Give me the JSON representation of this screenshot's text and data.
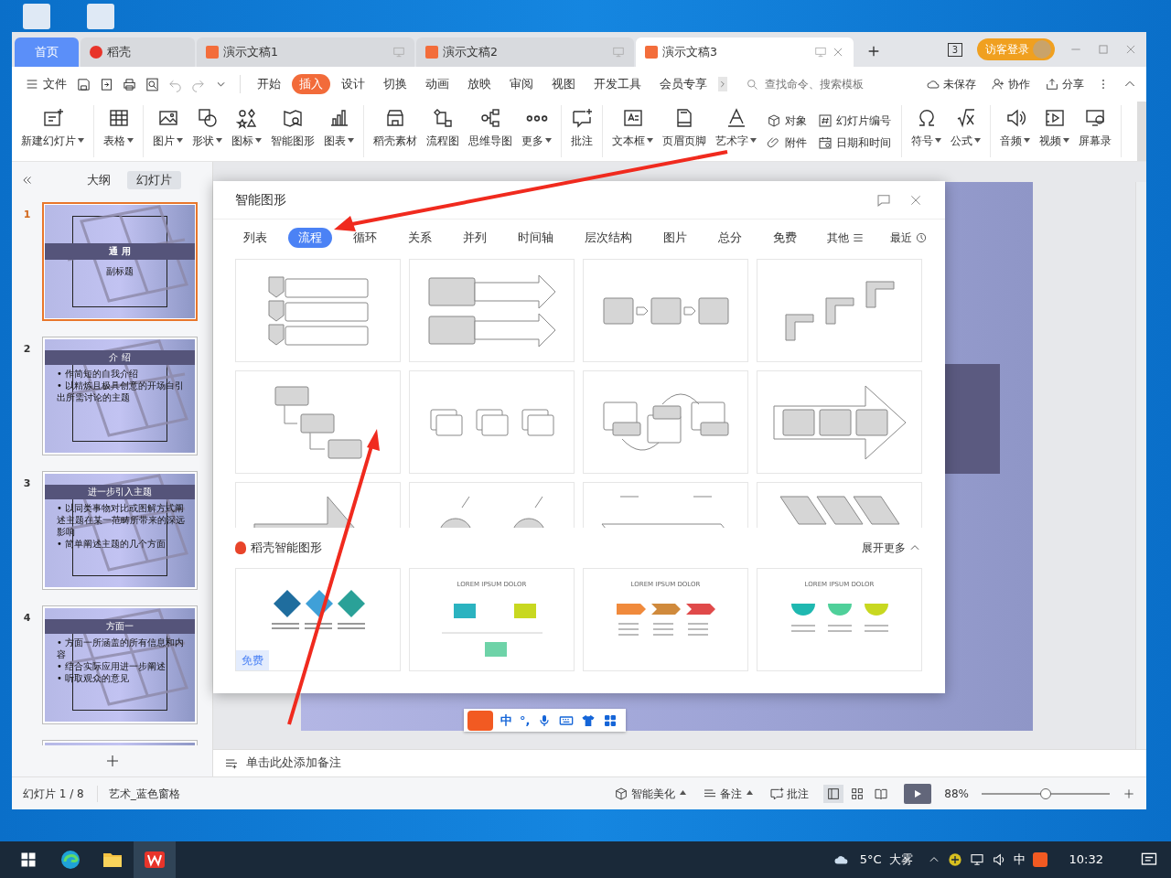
{
  "window_tabs": [
    {
      "label": "首页",
      "kind": "home",
      "selected": false
    },
    {
      "label": "稻壳",
      "kind": "daoke",
      "selected": false
    },
    {
      "label": "演示文稿1",
      "kind": "doc",
      "selected": false
    },
    {
      "label": "演示文稿2",
      "kind": "doc",
      "selected": false
    },
    {
      "label": "演示文稿3",
      "kind": "doc",
      "selected": true
    }
  ],
  "window_count": "3",
  "login_button": "访客登录",
  "file_menu": "文件",
  "menu_tabs": [
    {
      "label": "开始",
      "selected": false
    },
    {
      "label": "插入",
      "selected": true
    },
    {
      "label": "设计",
      "selected": false
    },
    {
      "label": "切换",
      "selected": false
    },
    {
      "label": "动画",
      "selected": false
    },
    {
      "label": "放映",
      "selected": false
    },
    {
      "label": "审阅",
      "selected": false
    },
    {
      "label": "视图",
      "selected": false
    },
    {
      "label": "开发工具",
      "selected": false
    },
    {
      "label": "会员专享",
      "selected": false
    }
  ],
  "search": {
    "placeholder": "查找命令、搜索模板"
  },
  "right_actions": [
    "未保存",
    "协作",
    "分享"
  ],
  "ribbon_groups": [
    [
      {
        "kind": "large",
        "label": "新建幻灯片",
        "dropdown": true
      }
    ],
    [
      {
        "kind": "large",
        "label": "表格",
        "dropdown": true
      }
    ],
    [
      {
        "kind": "large",
        "label": "图片",
        "dropdown": true
      },
      {
        "kind": "large",
        "label": "形状",
        "dropdown": true
      },
      {
        "kind": "large",
        "label": "图标",
        "dropdown": true
      },
      {
        "kind": "large",
        "label": "智能图形",
        "dropdown": false
      },
      {
        "kind": "large",
        "label": "图表",
        "dropdown": true
      }
    ],
    [
      {
        "kind": "large",
        "label": "稻壳素材",
        "dropdown": false
      },
      {
        "kind": "large",
        "label": "流程图",
        "dropdown": false
      },
      {
        "kind": "large",
        "label": "思维导图",
        "dropdown": false
      },
      {
        "kind": "large",
        "label": "更多",
        "dropdown": true
      }
    ],
    [
      {
        "kind": "large",
        "label": "批注",
        "dropdown": false
      }
    ],
    [
      {
        "kind": "large",
        "label": "文本框",
        "dropdown": true
      },
      {
        "kind": "large",
        "label": "页眉页脚",
        "dropdown": false
      },
      {
        "kind": "large",
        "label": "艺术字",
        "dropdown": true
      },
      {
        "kind": "stack",
        "items": [
          "对象",
          "附件"
        ]
      },
      {
        "kind": "stack",
        "items": [
          "幻灯片编号",
          "日期和时间"
        ]
      }
    ],
    [
      {
        "kind": "large",
        "label": "符号",
        "dropdown": true
      },
      {
        "kind": "large",
        "label": "公式",
        "dropdown": true
      }
    ],
    [
      {
        "kind": "large",
        "label": "音频",
        "dropdown": true
      },
      {
        "kind": "large",
        "label": "视频",
        "dropdown": true
      },
      {
        "kind": "large",
        "label": "屏幕录",
        "dropdown": false
      }
    ]
  ],
  "panel_tabs": [
    {
      "label": "大纲",
      "selected": false
    },
    {
      "label": "幻灯片",
      "selected": true
    }
  ],
  "slides": [
    {
      "number": "1",
      "selected": true,
      "kind": "title",
      "title": "通 用",
      "subtitle": "副标题"
    },
    {
      "number": "2",
      "selected": false,
      "kind": "content",
      "title": "介 绍",
      "bullets": [
        "• 作简短的自我介绍",
        "• 以精炼且极具创意的开场白引出所需讨论的主题"
      ]
    },
    {
      "number": "3",
      "selected": false,
      "kind": "content",
      "title": "进一步引入主题",
      "bullets": [
        "• 以同类事物对比或图解方式阐述主题在某一范畴所带来的深远影响",
        "• 简单阐述主题的几个方面"
      ]
    },
    {
      "number": "4",
      "selected": false,
      "kind": "content",
      "title": "方面一",
      "bullets": [
        "• 方面一所涵盖的所有信息和内容",
        "• 结合实际应用进一步阐述",
        "• 听取观众的意见"
      ]
    }
  ],
  "notes_placeholder": "单击此处添加备注",
  "dialog": {
    "title": "智能图形",
    "categories": [
      {
        "label": "列表",
        "selected": false
      },
      {
        "label": "流程",
        "selected": true
      },
      {
        "label": "循环",
        "selected": false
      },
      {
        "label": "关系",
        "selected": false
      },
      {
        "label": "并列",
        "selected": false
      },
      {
        "label": "时间轴",
        "selected": false
      },
      {
        "label": "层次结构",
        "selected": false
      },
      {
        "label": "图片",
        "selected": false
      },
      {
        "label": "总分",
        "selected": false
      },
      {
        "label": "免费",
        "selected": false
      }
    ],
    "others": "其他",
    "recent": "最近",
    "section_title": "稻壳智能图形",
    "expand": "展开更多",
    "cards": [
      {
        "kind": "diamonds",
        "badge": "免费"
      },
      {
        "kind": "timeline",
        "title": "LOREM IPSUM DOLOR"
      },
      {
        "kind": "chevrons",
        "title": "LOREM IPSUM DOLOR"
      },
      {
        "kind": "semicircles",
        "title": "LOREM IPSUM DOLOR"
      }
    ]
  },
  "ime": {
    "mode": "中",
    "punct": "°,"
  },
  "status": {
    "slide_info": "幻灯片 1 / 8",
    "theme": "艺术_蓝色窗格",
    "beautify": "智能美化",
    "notes": "备注",
    "comment": "批注",
    "zoom": "88%",
    "zoom_slider": {
      "level": 0.5
    }
  },
  "view_modes": [
    {
      "selected": true
    },
    {
      "selected": false
    },
    {
      "selected": false
    }
  ],
  "taskbar": {
    "apps": [
      {
        "kind": "edge",
        "selected": false
      },
      {
        "kind": "folder",
        "selected": false
      },
      {
        "kind": "wps",
        "selected": true
      }
    ],
    "temperature": "5°C",
    "weather": "大雾",
    "input_mode": "中",
    "time": "10:32"
  }
}
